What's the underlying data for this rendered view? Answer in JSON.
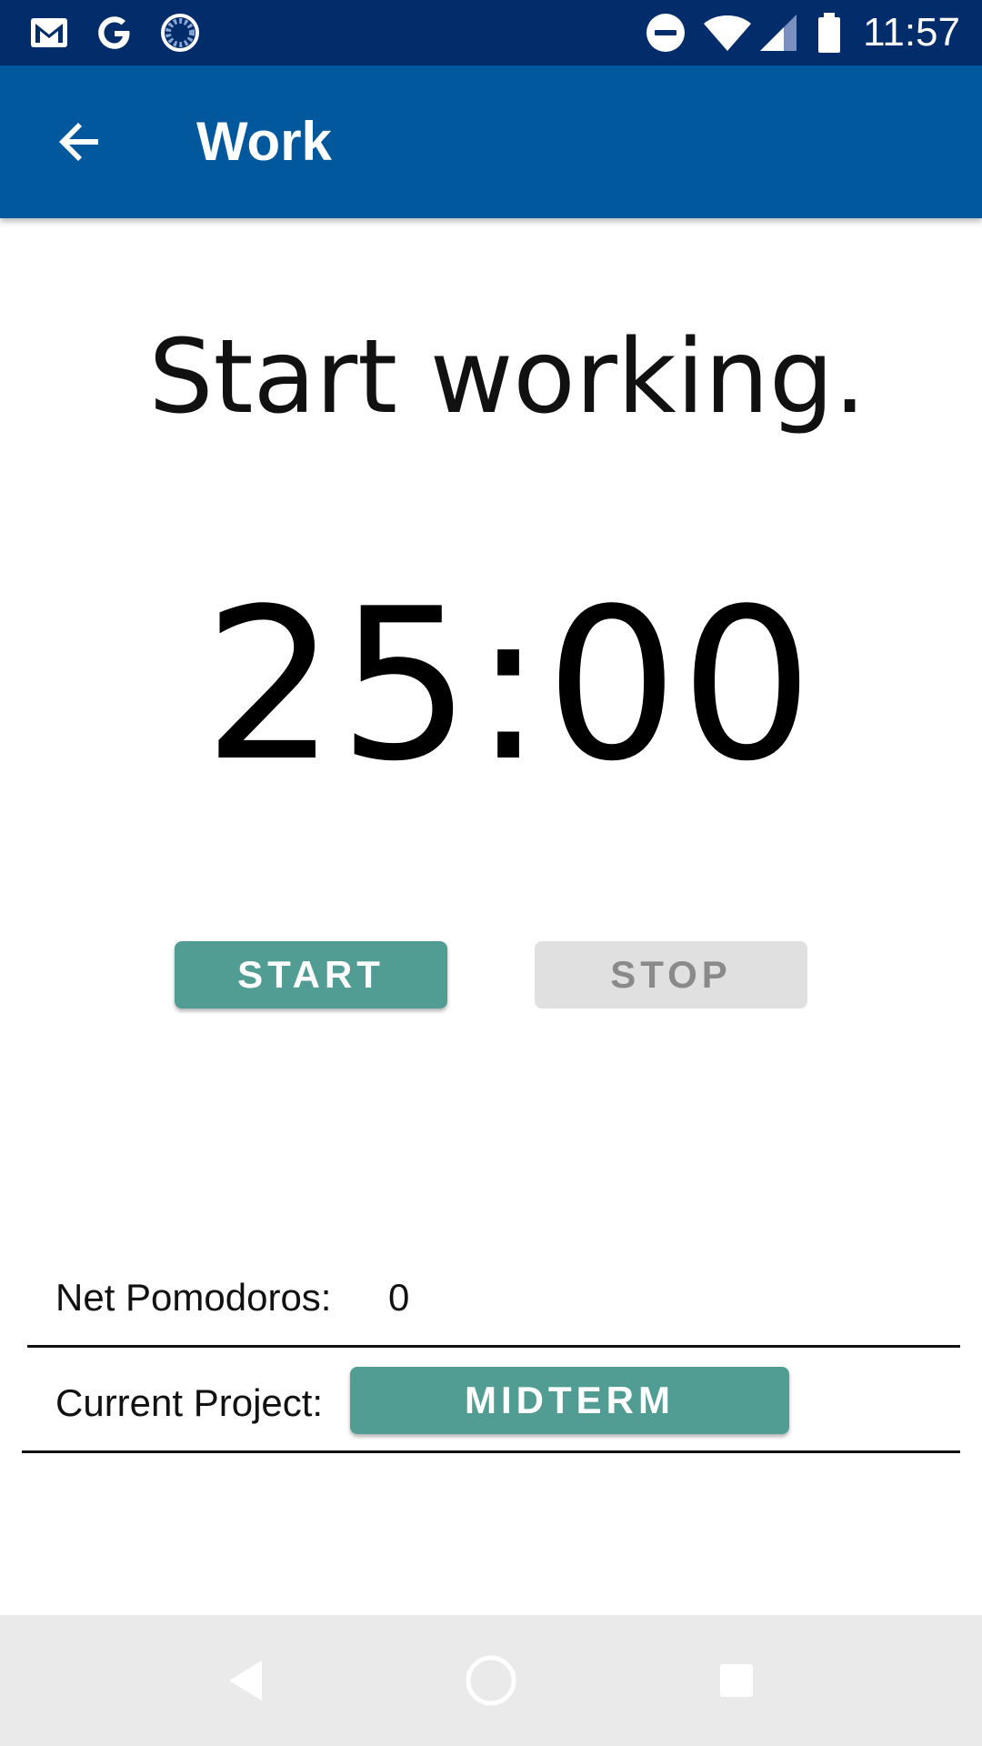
{
  "status_bar": {
    "time": "11:57",
    "icons": [
      "gmail-icon",
      "google-icon",
      "sync-icon",
      "do-not-disturb-icon",
      "wifi-icon",
      "cell-signal-icon",
      "battery-icon"
    ]
  },
  "app_bar": {
    "title": "Work",
    "back_icon": "arrow-back-icon"
  },
  "main": {
    "heading": "Start working.",
    "timer": "25:00",
    "start_label": "START",
    "stop_label": "STOP"
  },
  "stats": {
    "net_pomodoros_label": "Net Pomodoros:",
    "net_pomodoros_value": "0",
    "current_project_label": "Current Project:",
    "current_project_value": "MIDTERM"
  },
  "nav_bar": {
    "icons": [
      "nav-back-icon",
      "nav-home-icon",
      "nav-recents-icon"
    ]
  },
  "colors": {
    "status_bar": "#022d6a",
    "app_bar": "#02589d",
    "accent": "#519d94",
    "disabled_button": "#e0e0e0",
    "nav_bar": "#eaeaea"
  }
}
